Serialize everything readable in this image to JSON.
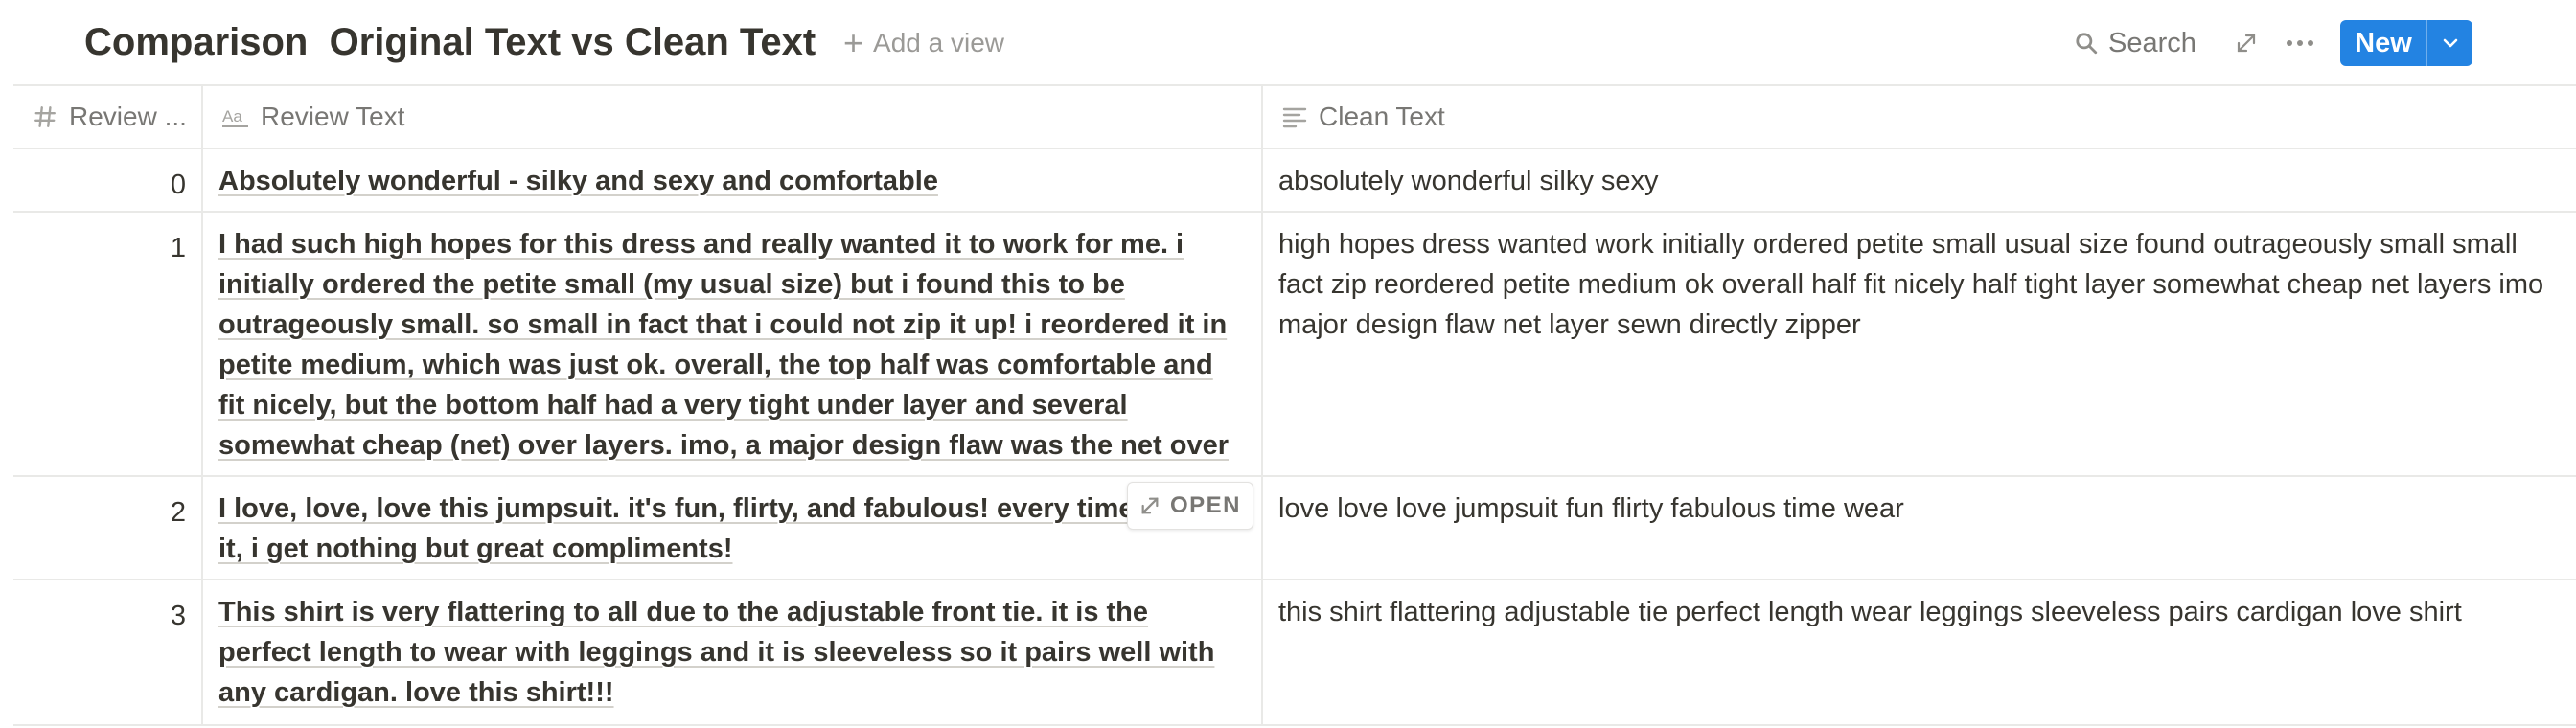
{
  "header": {
    "title": "Comparison  Original Text vs Clean Text",
    "add_view": "Add a view",
    "search": "Search",
    "new_button": "New"
  },
  "table": {
    "columns": [
      {
        "label": "Review ...",
        "icon": "number-icon"
      },
      {
        "label": "Review Text",
        "icon": "text-type-icon"
      },
      {
        "label": "Clean Text",
        "icon": "lines-icon"
      }
    ],
    "rows": [
      {
        "num": "0",
        "review": "Absolutely wonderful - silky and sexy and comfortable",
        "clean": "absolutely wonderful silky sexy"
      },
      {
        "num": "1",
        "review": "I had such high hopes for this dress and really wanted it to work for me. i initially ordered the petite small (my usual size) but i found this to be outrageously small. so small in fact that i could not zip it up! i reordered it in petite medium, which was just ok. overall, the top half was comfortable and fit nicely, but the bottom half had a very tight under layer and several somewhat cheap (net) over layers. imo, a major design flaw was the net over layer sewn directly into the zipper - it c",
        "clean": "high hopes dress wanted work initially ordered petite small usual size found outrageously small small fact zip reordered petite medium ok overall half fit nicely half tight layer somewhat cheap net layers imo major design flaw net layer sewn directly zipper"
      },
      {
        "num": "2",
        "review": "I love, love, love this jumpsuit. it's fun, flirty, and fabulous! every time i wear it, i get nothing but great compliments!",
        "clean": "love love love jumpsuit fun flirty fabulous time wear"
      },
      {
        "num": "3",
        "review": "This shirt is very flattering to all due to the adjustable front tie. it is the perfect length to wear with leggings and it is sleeveless so it pairs well with any cardigan. love this shirt!!!",
        "clean": "this shirt flattering adjustable tie perfect length wear leggings sleeveless pairs cardigan love shirt"
      }
    ],
    "open_label": "OPEN"
  },
  "colors": {
    "accent": "#2383e2",
    "text": "#37352f",
    "muted": "#787774",
    "border": "#e9e9e7"
  }
}
